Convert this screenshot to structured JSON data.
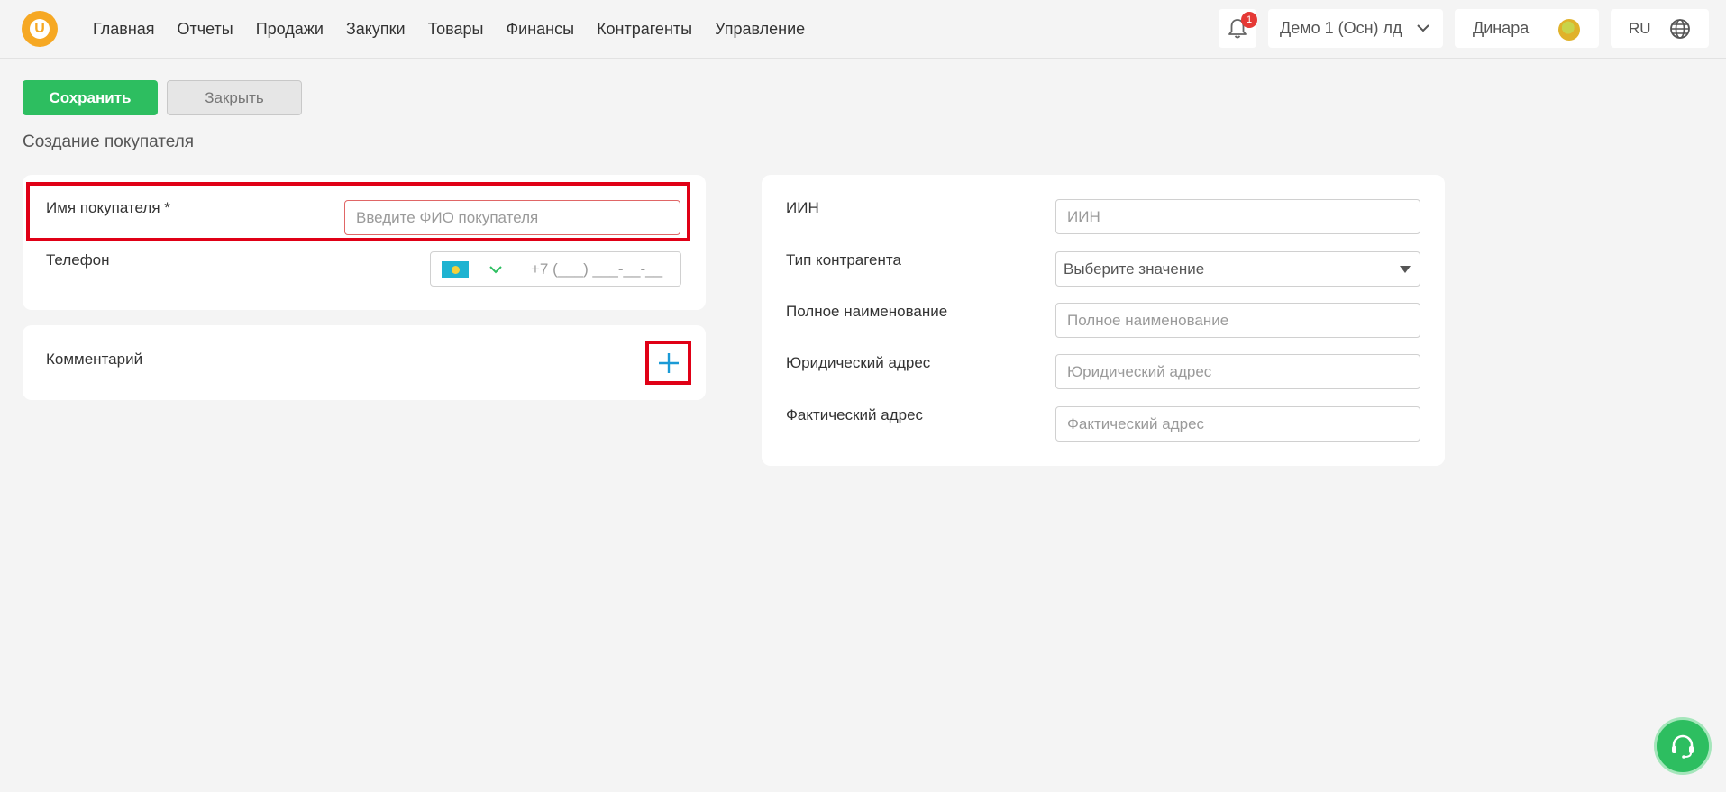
{
  "header": {
    "logo_letter": "U",
    "nav": [
      "Главная",
      "Отчеты",
      "Продажи",
      "Закупки",
      "Товары",
      "Финансы",
      "Контрагенты",
      "Управление"
    ],
    "notifications_count": "1",
    "company": "Демо 1 (Осн) лд",
    "user_name": "Динара",
    "language": "RU"
  },
  "toolbar": {
    "save_label": "Сохранить",
    "close_label": "Закрыть"
  },
  "page_title": "Создание покупателя",
  "left_form": {
    "name_label": "Имя покупателя *",
    "name_placeholder": "Введите ФИО покупателя",
    "phone_label": "Телефон",
    "phone_placeholder": "+7 (___) ___-__-__",
    "comment_label": "Комментарий"
  },
  "right_form": {
    "iin_label": "ИИН",
    "iin_placeholder": "ИИН",
    "type_label": "Тип контрагента",
    "type_value": "Выберите значение",
    "fullname_label": "Полное наименование",
    "fullname_placeholder": "Полное наименование",
    "legal_address_label": "Юридический адрес",
    "legal_address_placeholder": "Юридический адрес",
    "actual_address_label": "Фактический адрес",
    "actual_address_placeholder": "Фактический адрес"
  },
  "colors": {
    "primary_green": "#2dbe60",
    "logo_orange": "#f6a823",
    "highlight_red": "#e00016",
    "plus_blue": "#1a9ad6"
  },
  "icons": [
    "bell-icon",
    "chevron-down-icon",
    "globe-icon",
    "kz-flag-icon",
    "plus-icon",
    "headset-icon"
  ]
}
